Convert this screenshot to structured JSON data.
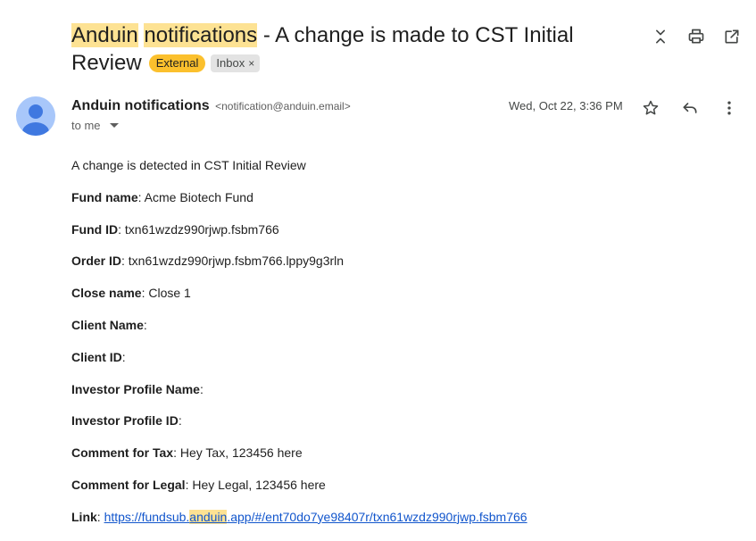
{
  "subject": {
    "part_hl_1": "Anduin",
    "part_space": " ",
    "part_hl_2": "notifications",
    "part_rest": " - A change is made to CST Initial Review",
    "badge_external": "External",
    "badge_inbox": "Inbox",
    "badge_close": "×"
  },
  "top_icons": [
    "collapse-icon",
    "print-icon",
    "open-new-window-icon"
  ],
  "sender": {
    "name": "Anduin notifications",
    "email": "<notification@anduin.email>",
    "to": "to me",
    "date": "Wed, Oct 22, 3:36 PM"
  },
  "message_icons": [
    "star-icon",
    "reply-icon",
    "more-vert-icon"
  ],
  "body": {
    "intro": "A change is detected in CST Initial Review",
    "fields": [
      {
        "label": "Fund name",
        "value": " Acme Biotech Fund"
      },
      {
        "label": "Fund ID",
        "value": " txn61wzdz990rjwp.fsbm766"
      },
      {
        "label": "Order ID",
        "value": " txn61wzdz990rjwp.fsbm766.lppy9g3rln"
      },
      {
        "label": "Close name",
        "value": " Close 1"
      },
      {
        "label": "Client Name",
        "value": ""
      },
      {
        "label": "Client ID",
        "value": ""
      },
      {
        "label": "Investor Profile Name",
        "value": ""
      },
      {
        "label": "Investor Profile ID",
        "value": ""
      },
      {
        "label": "Comment for Tax",
        "value": " Hey Tax, 123456 here"
      },
      {
        "label": "Comment for Legal",
        "value": " Hey Legal, 123456 here"
      }
    ],
    "link_label": "Link",
    "link_pre": "https://fundsub.",
    "link_hl": "anduin",
    "link_post": ".app/#/ent70do7ye98407r/txn61wzdz990rjwp.fsbm766"
  },
  "colors": {
    "highlight": "#fde293",
    "external_badge": "#fbc02d",
    "avatar_bg": "#a8c7fa",
    "avatar_fg": "#3f78e0",
    "link": "#1155cc"
  }
}
